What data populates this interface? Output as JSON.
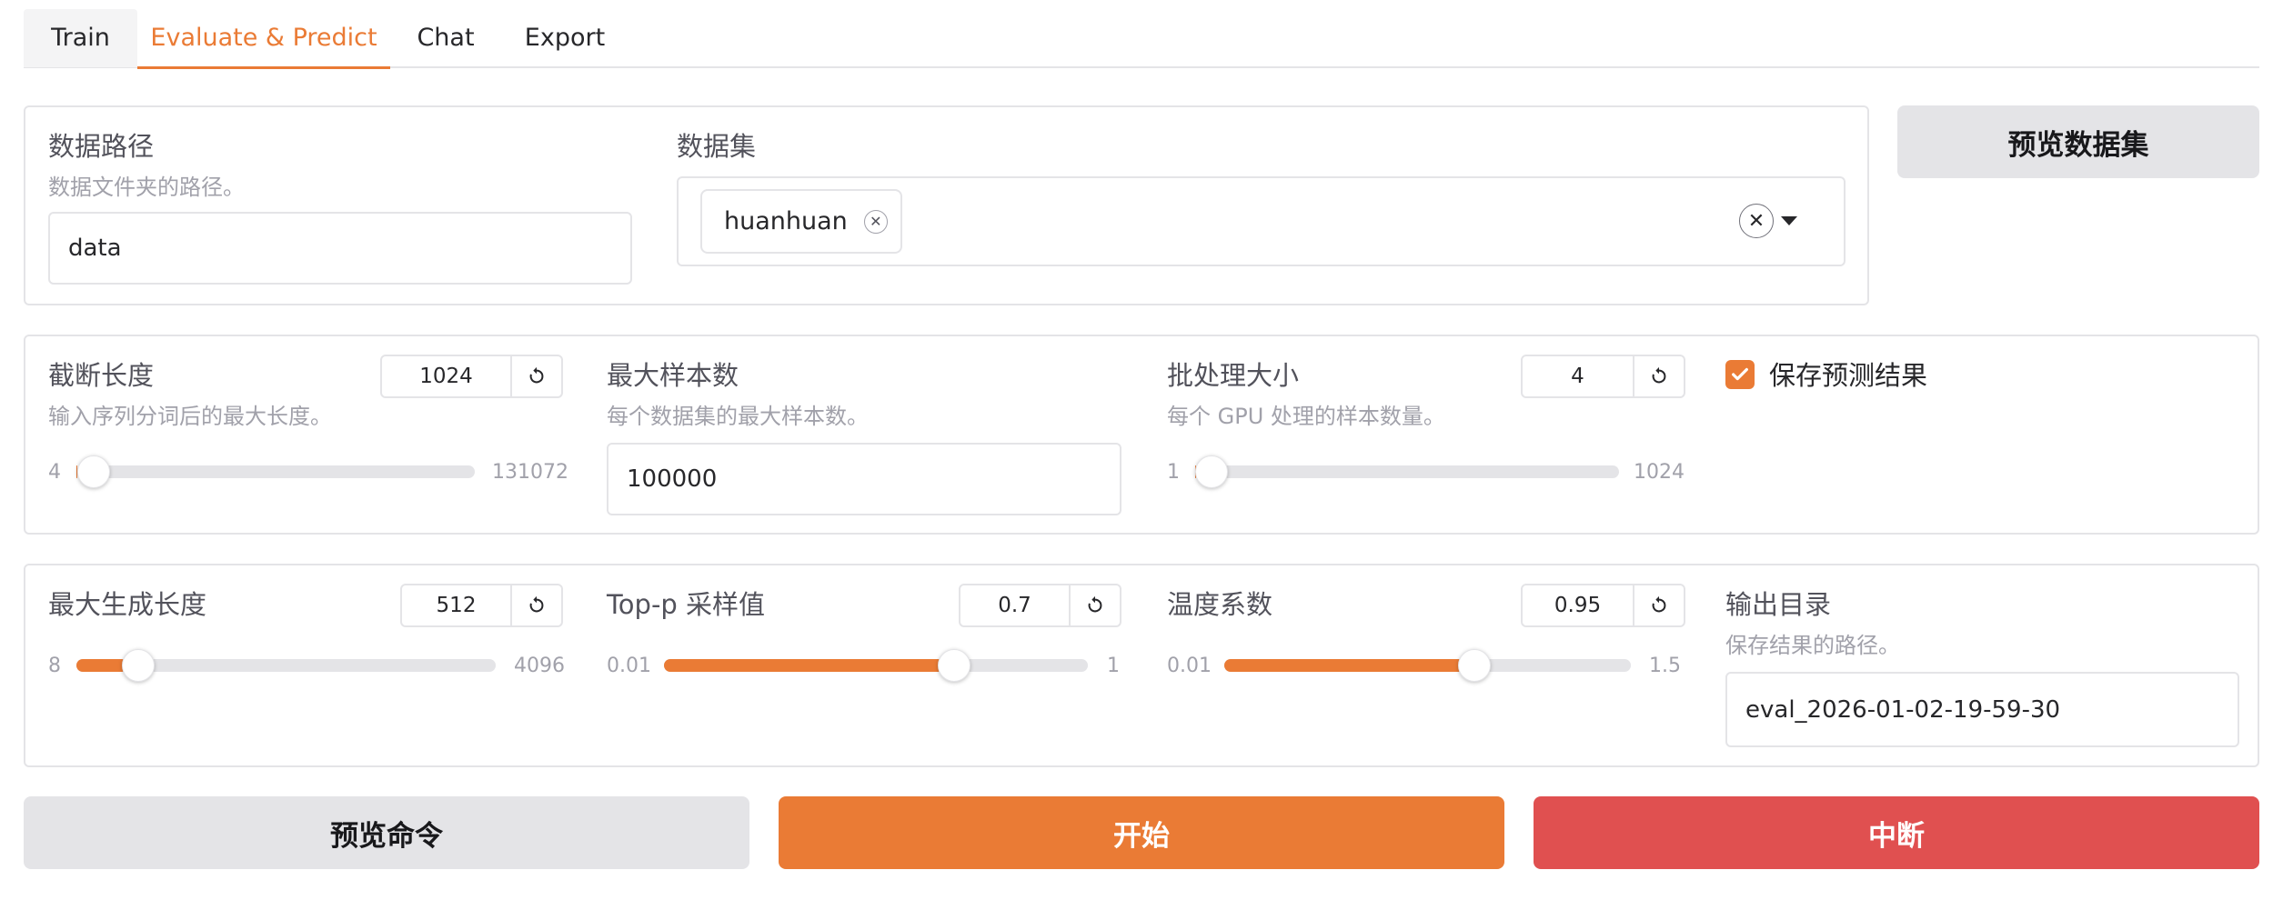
{
  "tabs": [
    {
      "label": "Train"
    },
    {
      "label": "Evaluate & Predict"
    },
    {
      "label": "Chat"
    },
    {
      "label": "Export"
    }
  ],
  "selected_tab": "Evaluate & Predict",
  "data_path": {
    "label": "数据路径",
    "info": "数据文件夹的路径。",
    "value": "data"
  },
  "dataset": {
    "label": "数据集",
    "chips": [
      "huanhuan"
    ]
  },
  "preview_dataset_button": "预览数据集",
  "cutoff_len": {
    "label": "截断长度",
    "info": "输入序列分词后的最大长度。",
    "value": "1024",
    "min": "4",
    "max": "131072",
    "fraction": 0.0024
  },
  "max_samples": {
    "label": "最大样本数",
    "info": "每个数据集的最大样本数。",
    "value": "100000"
  },
  "batch_size": {
    "label": "批处理大小",
    "info": "每个 GPU 处理的样本数量。",
    "value": "4",
    "min": "1",
    "max": "1024",
    "fraction": 0.003
  },
  "predict_checkbox": {
    "label": "保存预测结果",
    "checked": true
  },
  "max_new_tokens": {
    "label": "最大生成长度",
    "value": "512",
    "min": "8",
    "max": "4096",
    "fraction": 0.123
  },
  "top_p": {
    "label": "Top-p 采样值",
    "value": "0.7",
    "min": "0.01",
    "max": "1",
    "fraction": 0.697
  },
  "temperature": {
    "label": "温度系数",
    "value": "0.95",
    "min": "0.01",
    "max": "1.5",
    "fraction": 0.631
  },
  "output_dir": {
    "label": "输出目录",
    "info": "保存结果的路径。",
    "value": "eval_2026-01-02-19-59-30"
  },
  "buttons": {
    "preview_cmd": "预览命令",
    "start": "开始",
    "stop": "中断"
  },
  "colors": {
    "accent": "#ea7b35",
    "stop": "#e05050",
    "secondary": "#e4e4e7"
  }
}
